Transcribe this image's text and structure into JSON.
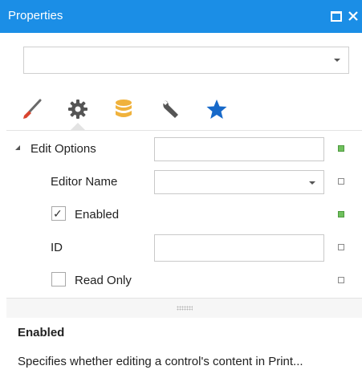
{
  "window": {
    "title": "Properties"
  },
  "selector": {
    "value": ""
  },
  "tabs": [
    {
      "icon": "paintbrush-icon"
    },
    {
      "icon": "gear-icon"
    },
    {
      "icon": "database-icon"
    },
    {
      "icon": "wrench-icon"
    },
    {
      "icon": "star-icon"
    }
  ],
  "properties": {
    "edit_options": {
      "label": "Edit Options",
      "value": "",
      "modified": true
    },
    "editor_name": {
      "label": "Editor Name",
      "value": "",
      "modified": false
    },
    "enabled": {
      "label": "Enabled",
      "checked": true,
      "modified": true
    },
    "id": {
      "label": "ID",
      "value": "",
      "modified": false
    },
    "read_only": {
      "label": "Read Only",
      "checked": false,
      "modified": false
    }
  },
  "description": {
    "title": "Enabled",
    "text": "Specifies whether editing a control's content in Print..."
  },
  "colors": {
    "titlebar": "#1b8ee6",
    "modified_marker": "#6fc05d",
    "brush_tip": "#d9442f",
    "database": "#f0b23c",
    "star": "#1769c9"
  }
}
